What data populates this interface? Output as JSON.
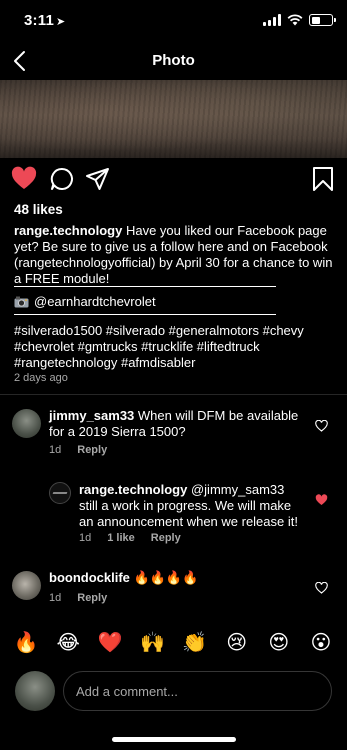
{
  "status": {
    "time": "3:11",
    "battery_level": 0.45
  },
  "nav": {
    "title": "Photo"
  },
  "post": {
    "likes": "48 likes",
    "author": "range.technology",
    "caption": " Have you liked our Facebook page yet? Be sure to give us a follow here and on Facebook (rangetechnologyofficial) by April 30 for a chance to win a FREE module!",
    "mention": "@earnhardtchevrolet",
    "hashtags": "#silverado1500 #silverado #generalmotors #chevy #chevrolet #gmtrucks #trucklife #liftedtruck #rangetechnology #afmdisabler",
    "time": "2 days ago",
    "liked": true
  },
  "comments": [
    {
      "user": "jimmy_sam33",
      "text": " When will DFM be available for a 2019 Sierra 1500?",
      "age": "1d",
      "reply": "Reply",
      "liked": false
    },
    {
      "user": "range.technology",
      "text": " @jimmy_sam33 still a work in progress. We will make an announcement when we release it!",
      "age": "1d",
      "likes": "1 like",
      "reply": "Reply",
      "liked": true
    },
    {
      "user": "boondocklife",
      "text": " 🔥🔥🔥🔥",
      "age": "1d",
      "reply": "Reply",
      "liked": false
    }
  ],
  "emoji_bar": [
    "🔥",
    "😂",
    "❤️",
    "🙌",
    "👏",
    "😢",
    "😍",
    "😮"
  ],
  "composer": {
    "placeholder": "Add a comment..."
  },
  "colors": {
    "like_red": "#ed4956",
    "muted": "#a8a8a8",
    "border": "#363636"
  }
}
